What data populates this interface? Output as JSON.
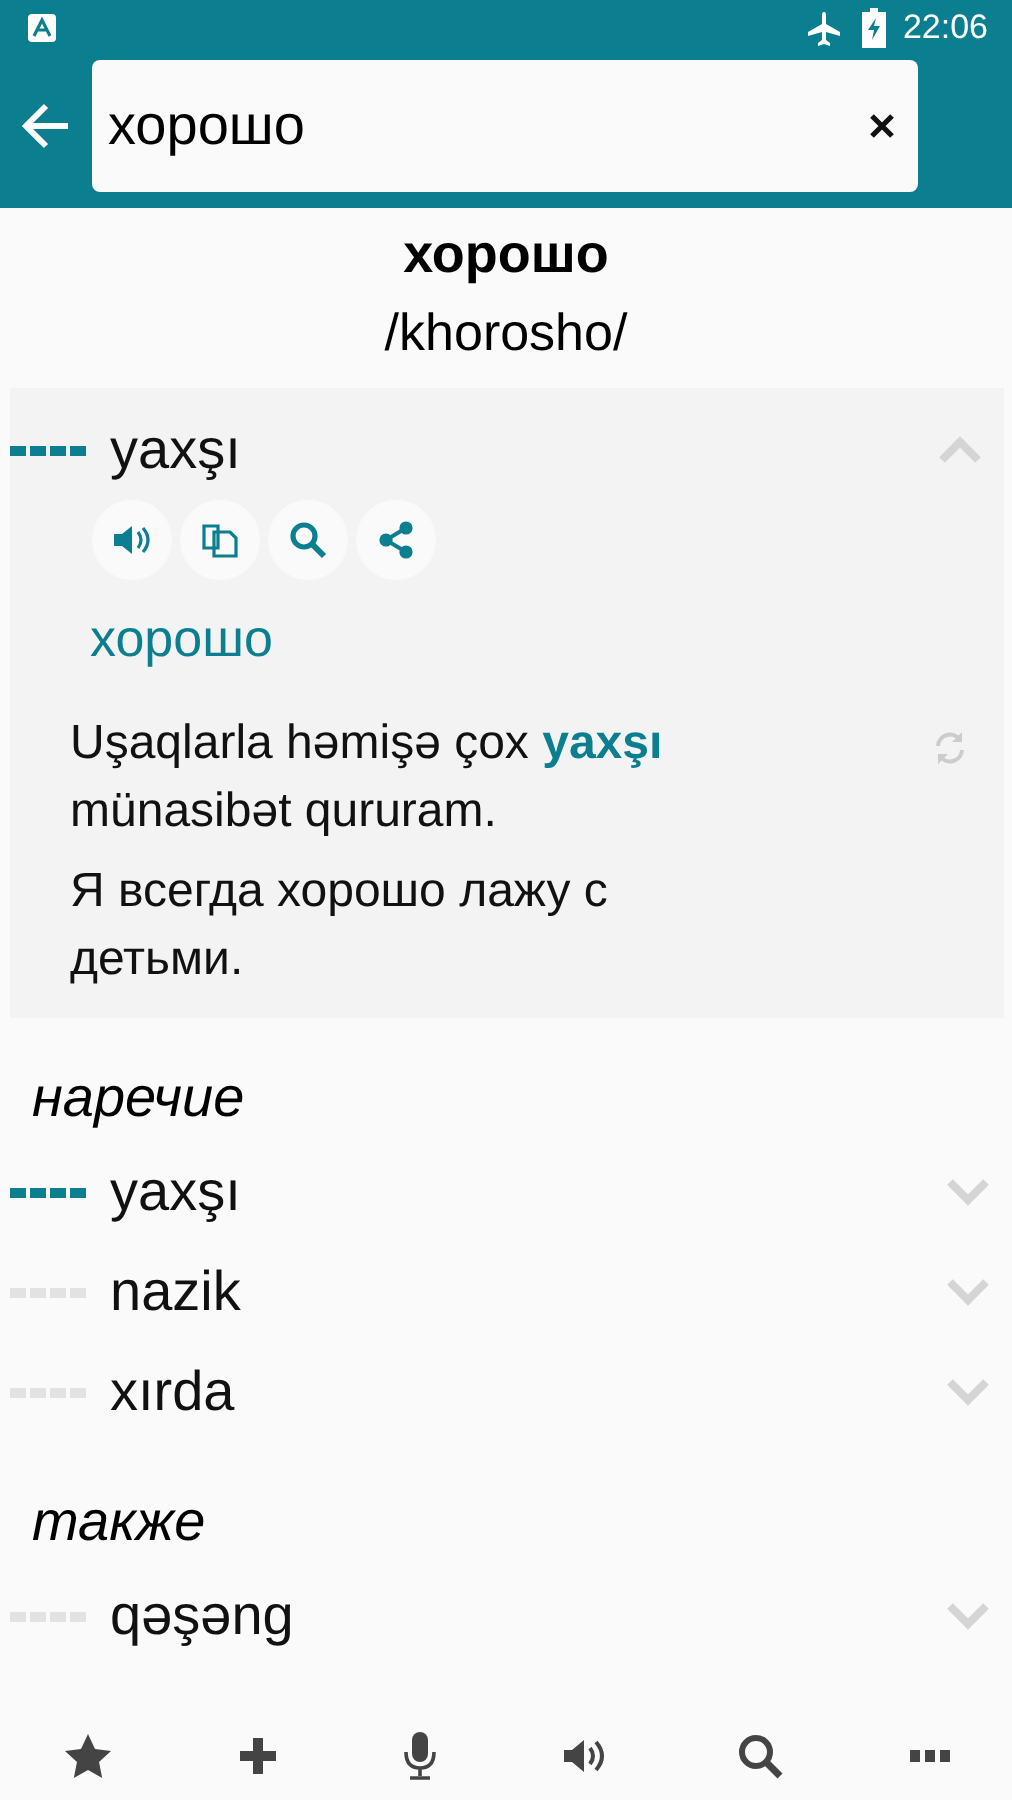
{
  "status_bar": {
    "time": "22:06"
  },
  "search": {
    "value": "хорошо"
  },
  "headword": "хорошо",
  "transcription": "/khorosho/",
  "top_result": {
    "word": "yaxşı",
    "frequent": true,
    "expanded": true,
    "translation": "хорошо",
    "example": "Uşaqlarla həmişə çox **yaxşı** münasibət qururam.",
    "example_translation": "Я всегда хорошо лажу с детьми."
  },
  "sections": [
    {
      "title": "наречие",
      "items": [
        {
          "word": "yaxşı",
          "frequent": true,
          "expanded": false
        },
        {
          "word": "nazik",
          "frequent": false,
          "expanded": false
        },
        {
          "word": "xırda",
          "frequent": false,
          "expanded": false
        }
      ]
    },
    {
      "title": "также",
      "items": [
        {
          "word": "qəşəng",
          "frequent": false,
          "expanded": false
        }
      ]
    }
  ]
}
